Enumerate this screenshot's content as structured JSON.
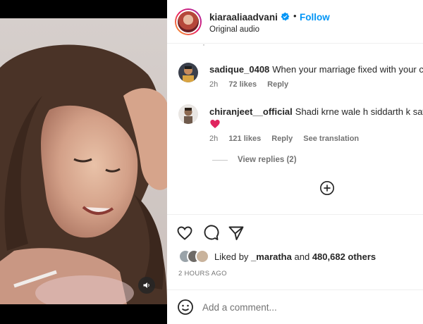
{
  "post": {
    "username": "kiaraaliaadvani",
    "follow_label": "Follow",
    "separator": "•",
    "audio_label": "Original audio"
  },
  "comments": [
    {
      "username": "sadique_0408",
      "text": "When your marriage fixed with your crush",
      "time": "2h",
      "likes": "72 likes",
      "reply_label": "Reply"
    },
    {
      "username": "chiranjeet__official",
      "text": "Shadi krne wale h siddarth k sath isiliye",
      "emoji": "red-heart",
      "time": "2h",
      "likes": "121 likes",
      "reply_label": "Reply",
      "translate_label": "See translation"
    }
  ],
  "view_replies_label": "View replies (2)",
  "liked_by": {
    "prefix": "Liked by",
    "user": "_maratha",
    "joiner": "and",
    "others": "480,682 others"
  },
  "timestamp": "2 HOURS AGO",
  "add_comment": {
    "placeholder": "Add a comment..."
  },
  "icons": {
    "verified": "verified-badge-icon",
    "mute": "speaker-icon",
    "like": "heart-icon",
    "comment": "comment-icon",
    "share": "send-icon",
    "load_more": "plus-circle-icon",
    "emoji": "smiley-icon"
  },
  "colors": {
    "follow": "#0095f6",
    "verified": "#0095f6",
    "heart": "#ed4956",
    "muted_text": "#737373"
  }
}
